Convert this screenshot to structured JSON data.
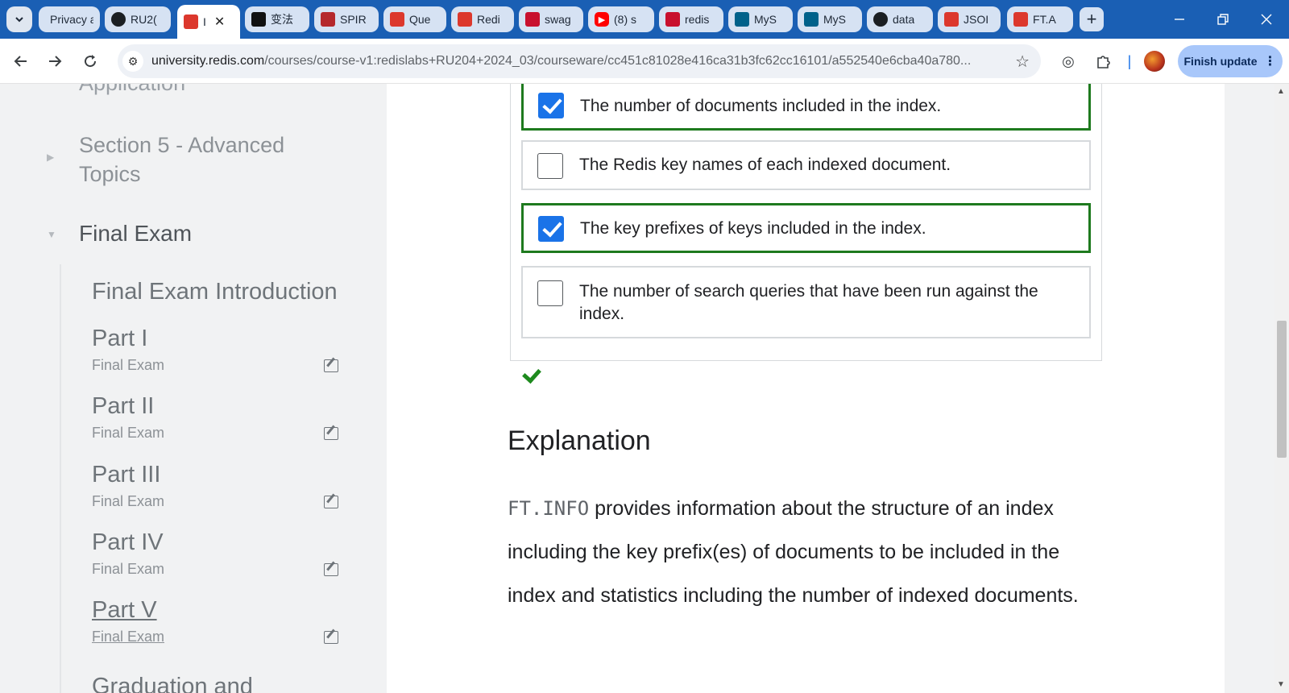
{
  "browser": {
    "tabs": [
      {
        "title": "Privacy a",
        "icon": "edge-icon",
        "color": "#5a6b7d"
      },
      {
        "title": "RU2(",
        "icon": "github-icon",
        "color": "#1b1f23"
      },
      {
        "title": "I",
        "icon": "redis-cube-icon",
        "color": "#dc382d"
      },
      {
        "title": "变法",
        "icon": "chatbot-icon",
        "color": "#111111"
      },
      {
        "title": "SPIR",
        "icon": "shield-crest-icon",
        "color": "#b5282c"
      },
      {
        "title": "Que",
        "icon": "redis-cube-icon",
        "color": "#dc382d"
      },
      {
        "title": "Redi",
        "icon": "redis-logo-icon",
        "color": "#dc382d"
      },
      {
        "title": "swag",
        "icon": "n-logo-icon",
        "color": "#c8102e"
      },
      {
        "title": "(8) s",
        "icon": "youtube-icon",
        "color": "#ff0000"
      },
      {
        "title": "redis",
        "icon": "n-logo-icon",
        "color": "#c8102e"
      },
      {
        "title": "MyS",
        "icon": "mysql-icon",
        "color": "#00618a"
      },
      {
        "title": "MyS",
        "icon": "mysql-icon",
        "color": "#00618a"
      },
      {
        "title": "data",
        "icon": "github-icon",
        "color": "#1b1f23"
      },
      {
        "title": "JSOI",
        "icon": "redis-cube-icon",
        "color": "#dc382d"
      },
      {
        "title": "FT.A",
        "icon": "redis-cube-icon",
        "color": "#dc382d"
      }
    ],
    "url_host": "university.redis.com",
    "url_path": "/courses/course-v1:redislabs+RU204+2024_03/courseware/cc451c81028e416ca31b3fc62cc16101/a552540e6cba40a780...",
    "finish_update_label": "Finish update"
  },
  "sidebar": {
    "cut_item": "Application",
    "section5": "Section 5 - Advanced Topics",
    "final_exam": "Final Exam",
    "intro": "Final Exam Introduction",
    "units": [
      {
        "title": "Part I",
        "subtitle": "Final Exam"
      },
      {
        "title": "Part II",
        "subtitle": "Final Exam"
      },
      {
        "title": "Part III",
        "subtitle": "Final Exam"
      },
      {
        "title": "Part IV",
        "subtitle": "Final Exam"
      },
      {
        "title": "Part V",
        "subtitle": "Final Exam"
      }
    ],
    "graduation": "Graduation and"
  },
  "quiz": {
    "choices": [
      {
        "text": "The number of documents included in the index.",
        "checked": true,
        "correct": true
      },
      {
        "text": "The Redis key names of each indexed document.",
        "checked": false,
        "correct": false
      },
      {
        "text": "The key prefixes of keys included in the index.",
        "checked": true,
        "correct": true
      },
      {
        "text": "The number of search queries that have been run against the index.",
        "checked": false,
        "correct": false
      }
    ]
  },
  "explanation": {
    "heading": "Explanation",
    "code": "FT.INFO",
    "body": " provides information about the structure of an index including the key prefix(es) of documents to be included in the index and statistics including the number of indexed documents."
  },
  "colors": {
    "tab_strip": "#1a5fb4",
    "correct_border": "#1e7a1e",
    "checkbox_checked": "#1a73e8"
  }
}
